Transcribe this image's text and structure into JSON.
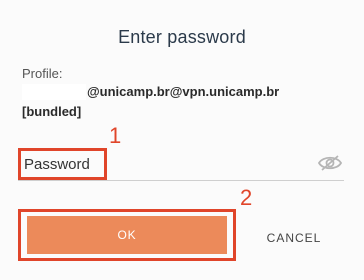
{
  "dialog": {
    "title": "Enter password",
    "profile_label": "Profile:",
    "profile_value_line1": "@unicamp.br@vpn.unicamp.br",
    "profile_value_line2": "[bundled]",
    "password_placeholder": "Password",
    "ok_label": "OK",
    "cancel_label": "CANCEL"
  },
  "annotations": {
    "step1": "1",
    "step2": "2"
  },
  "colors": {
    "accent": "#ec8a5a",
    "annotation": "#e0452a",
    "title": "#2b3a4a"
  },
  "icons": {
    "password_visibility": "eye-off-icon"
  }
}
